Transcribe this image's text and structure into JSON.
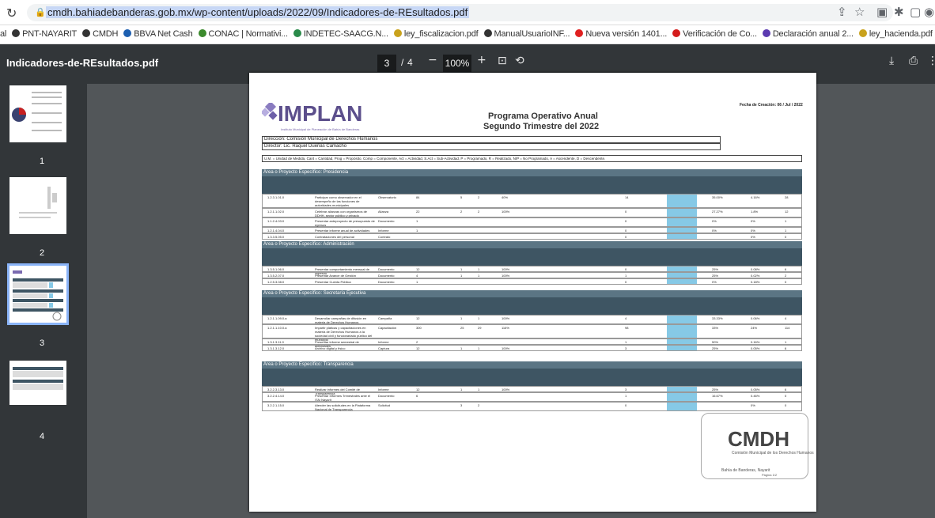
{
  "browser": {
    "url": "cmdh.bahiadebanderas.gob.mx/wp-content/uploads/2022/09/Indicadores-de-REsultados.pdf"
  },
  "bookmarks": [
    {
      "label": "al",
      "color": "#888"
    },
    {
      "label": "PNT-NAYARIT",
      "color": "#333"
    },
    {
      "label": "CMDH",
      "color": "#333"
    },
    {
      "label": "BBVA Net Cash",
      "color": "#1d5fb0"
    },
    {
      "label": "CONAC | Normativi...",
      "color": "#3b8a2c"
    },
    {
      "label": "INDETEC-SAACG.N...",
      "color": "#2a8a4a"
    },
    {
      "label": "ley_fiscalizacion.pdf",
      "color": "#c9a21c"
    },
    {
      "label": "ManualUsuarioINF...",
      "color": "#333"
    },
    {
      "label": "Nueva versión 1401...",
      "color": "#e02020"
    },
    {
      "label": "Verificación de Co...",
      "color": "#d41c1c"
    },
    {
      "label": "Declaración anual 2...",
      "color": "#5b3ab0"
    },
    {
      "label": "ley_hacienda.pdf",
      "color": "#c9a21c"
    },
    {
      "label": "INDETEC-SAACG.N...",
      "color": "#2a8a4a"
    }
  ],
  "pdf": {
    "title": "Indicadores-de-REsultados.pdf",
    "page": "3",
    "sep": "/",
    "total": "4",
    "zoom": "100%"
  },
  "thumbs": [
    {
      "n": "1"
    },
    {
      "n": "2"
    },
    {
      "n": "3"
    },
    {
      "n": "4"
    }
  ],
  "doc": {
    "logo": "IMPLAN",
    "logo_sub": "Instituto Municipal de Planeación de Bahía de Banderas",
    "title1": "Programa Operativo Anual",
    "title2": "Segundo Trimestre del 2022",
    "fecha": "Fecha de Creación: 06 / Jul / 2022",
    "direccion": "Dirección: Comisión Municipal de Derechos Humanos",
    "director": "Director: Lic. Raquel Dueñas Camacho",
    "legend": "U.M. = Unidad de Medida, Cant = Cantidad, Prog = Propósito, Comp = Componente, Act = Actividad, S.Act = Sub-Actividad, P = Programado, R = Realizado, N/P = No Programado, A = Ascendente, D = Descendente.",
    "sections": [
      {
        "name": "Área o Proyecto Específico: Presidencia",
        "rows": [
          {
            "c": "1.2.3.1.01.0",
            "a": "Participar como observador en el desempeño de las funciones de autoridades municipales",
            "u": "Observatorio",
            "m": "84",
            "p": "5",
            "r": "2",
            "pc": "40%",
            "r2": "14",
            "s": "35.00%",
            "t": "4.16%",
            "z": "28"
          },
          {
            "c": "1.2.1.1.02.0",
            "a": "Celebrar alianzas con organismos de DDHH, sector público y privado",
            "u": "Alianza",
            "m": "22",
            "p": "2",
            "r": "2",
            "pc": "100%",
            "r2": "0",
            "s": "27.27%",
            "t": "1.8%",
            "z": "12"
          },
          {
            "c": "1.1.2.4.03.0",
            "a": "Presentar anteproyecto de presupuesto de egresos",
            "u": "Documento",
            "m": "1",
            "p": "",
            "r": "",
            "pc": "",
            "r2": "0",
            "s": "0%",
            "t": "0%",
            "z": "1"
          },
          {
            "c": "1.2.1.4.04.0",
            "a": "Presentar informe anual de actividades",
            "u": "Informe",
            "m": "1",
            "p": "",
            "r": "",
            "pc": "",
            "r2": "0",
            "s": "0%",
            "t": "0%",
            "z": "1"
          },
          {
            "c": "1.3.3.5.05.0",
            "a": "Contrataciones del personal",
            "u": "Contrato",
            "m": "",
            "p": "",
            "r": "",
            "pc": "",
            "r2": "0",
            "s": "",
            "t": "0%",
            "z": "0"
          }
        ]
      },
      {
        "name": "Área o Proyecto Específico: Administración",
        "rows": [
          {
            "c": "1.3.5.1.06.0",
            "a": "Presentar comportamiento mensual de ingresos",
            "u": "Documento",
            "m": "12",
            "p": "1",
            "r": "1",
            "pc": "100%",
            "r2": "0",
            "s": "25%",
            "t": "0.08%",
            "z": "6"
          },
          {
            "c": "1.3.5.2.07.0",
            "a": "Presentar Avance de Gestión",
            "u": "Documento",
            "m": "4",
            "p": "1",
            "r": "1",
            "pc": "100%",
            "r2": "1",
            "s": "25%",
            "t": "0.02%",
            "z": "2"
          },
          {
            "c": "1.2.5.3.08.0",
            "a": "Presentar Cuenta Pública",
            "u": "Documento",
            "m": "1",
            "p": "",
            "r": "",
            "pc": "",
            "r2": "0",
            "s": "0%",
            "t": "0.18%",
            "z": "0"
          }
        ]
      },
      {
        "name": "Área o Proyecto Específico: Secretaría Ejecutiva",
        "rows": [
          {
            "c": "1.2.1.1.09.0.a",
            "a": "Desarrollar campañas de difusión en materia de Derechos Humanos",
            "u": "Campaña",
            "m": "12",
            "p": "1",
            "r": "1",
            "pc": "100%",
            "r2": "4",
            "s": "33.33%",
            "t": "0.06%",
            "z": "4"
          },
          {
            "c": "1.2.1.1.10.0.a",
            "a": "Impartir pláticas y capacitaciones en materia de Derechos Humanos a la sociedad civil y funcionariado público del municipio",
            "u": "Capacitación",
            "m": "300",
            "p": "25",
            "r": "29",
            "pc": "116%",
            "r2": "98",
            "s": "33%",
            "t": "24%",
            "z": "114"
          },
          {
            "c": "1.3.1.3.11.0",
            "a": "Presentar informe semestral de actividades",
            "u": "Informe",
            "m": "2",
            "p": "",
            "r": "",
            "pc": "",
            "r2": "1",
            "s": "50%",
            "t": "0.16%",
            "z": "1"
          },
          {
            "c": "1.3.1.3.12.0",
            "a": "Archivo digital y físico",
            "u": "Captura",
            "m": "12",
            "p": "1",
            "r": "1",
            "pc": "100%",
            "r2": "3",
            "s": "25%",
            "t": "0.05%",
            "z": "6"
          }
        ]
      },
      {
        "name": "Área o Proyecto Específico: Transparencia",
        "rows": [
          {
            "c": "3.2.2.3.13.0",
            "a": "Realizar informes del Comité de Transparencia",
            "u": "Informe",
            "m": "12",
            "p": "1",
            "r": "1",
            "pc": "100%",
            "r2": "3",
            "s": "25%",
            "t": "0.05%",
            "z": "6"
          },
          {
            "c": "3.2.2.4.14.0",
            "a": "Presentar Informes Trimestrales ante el ITAI Nayarit",
            "u": "Documento",
            "m": "6",
            "p": "",
            "r": "",
            "pc": "",
            "r2": "1",
            "s": "16.67%",
            "t": "0.46%",
            "z": "0"
          },
          {
            "c": "3.2.2.1.15.0",
            "a": "Atender las solicitudes en la Plataforma Nacional de Transparencia",
            "u": "Solicitud",
            "m": "",
            "p": "3",
            "r": "2",
            "pc": "",
            "r2": "0",
            "s": "",
            "t": "0%",
            "z": "0"
          }
        ]
      }
    ],
    "seal": {
      "title": "CMDH",
      "line1": "Comisión Municipal de los Derechos Humanos",
      "line2": "Bahía de Banderas, Nayarit",
      "page": "Página 1/2"
    }
  }
}
